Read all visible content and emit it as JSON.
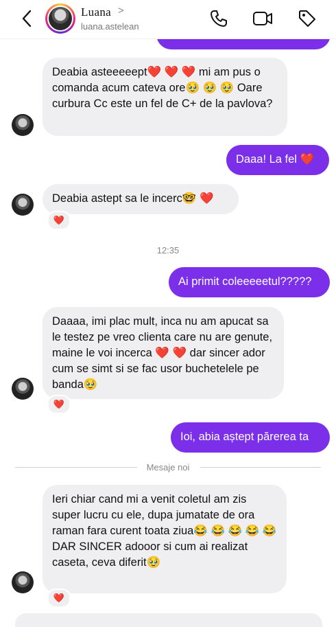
{
  "header": {
    "name": "Luana",
    "chevron": ">",
    "username": "luana.astelean"
  },
  "messages": [
    {
      "side": "in",
      "text": "Deabia asteeeeept❤️ ❤️ ❤️ mi am pus o comanda acum cateva ore🥹 🥹 🥹 Oare curbura Cc este un fel de C+ de la pavlova?"
    },
    {
      "side": "out",
      "text": "Daaa! La fel ❤️"
    },
    {
      "side": "in",
      "text": "Deabia astept sa le incerc🤓 ❤️",
      "reaction": "❤️"
    },
    {
      "side": "out",
      "text": "Ai primit coleeeeetul?????"
    },
    {
      "side": "in",
      "text": "Daaaa, imi plac mult, inca nu am apucat sa le testez pe vreo clienta care nu are genute, maine le voi incerca ❤️ ❤️ dar sincer ador cum se simt si se fac usor buchetelele pe banda🥹",
      "reaction": "❤️"
    },
    {
      "side": "out",
      "text": "Ioi, abia aștept părerea ta"
    },
    {
      "side": "in",
      "text": "Ieri chiar cand mi a venit coletul am zis super lucru cu ele, dupa jumatate de ora raman fara curent toata ziua😂 😂 😂 😂 😂 DAR SINCER adooor si cum ai realizat caseta, ceva diferit🥹",
      "reaction": "❤️"
    }
  ],
  "timestamp": "12:35",
  "divider": "Mesaje noi",
  "colors": {
    "accent": "#7b2fe8",
    "incoming_bubble": "#efeff2"
  },
  "icons": [
    "back-icon",
    "call-icon",
    "video-icon",
    "tag-icon"
  ]
}
